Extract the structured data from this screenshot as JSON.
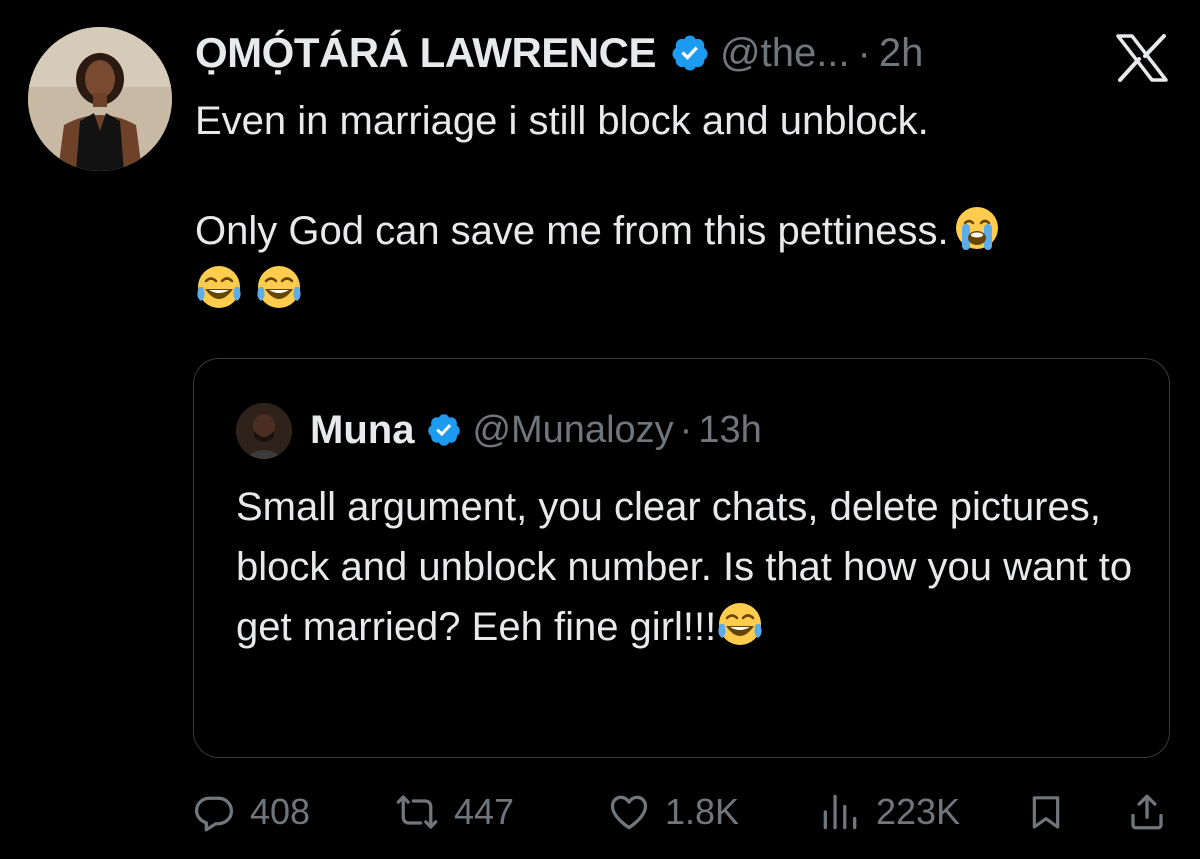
{
  "author": {
    "name": "ỌMỌ́TÁRÁ LAWRENCE",
    "handle": "@the...",
    "separator": "·",
    "time": "2h"
  },
  "tweet": {
    "line1": "Even in marriage i still block and unblock.",
    "line2": "Only God can save me from this pettiness."
  },
  "quoted": {
    "name": "Muna",
    "handle": "@Munalozy",
    "separator": "·",
    "time": "13h",
    "text": "Small argument, you clear chats, delete pictures, block and unblock number. Is that how you want to get married? Eeh fine girl!!!"
  },
  "actions": {
    "replies": "408",
    "reposts": "447",
    "likes": "1.8K",
    "views": "223K"
  },
  "icons": {
    "verified": "verified-badge-icon",
    "brand": "x-logo-icon",
    "reply": "reply-icon",
    "repost": "repost-icon",
    "like": "heart-icon",
    "views": "views-chart-icon",
    "bookmark": "bookmark-icon",
    "share": "share-icon",
    "emoji_crying": "loudly-crying-face-icon",
    "emoji_laughing": "tears-of-joy-icon"
  },
  "colors": {
    "background": "#000000",
    "text": "#e7e9ea",
    "muted": "#71767b",
    "verified": "#1d9bf0",
    "border": "#38393c"
  }
}
